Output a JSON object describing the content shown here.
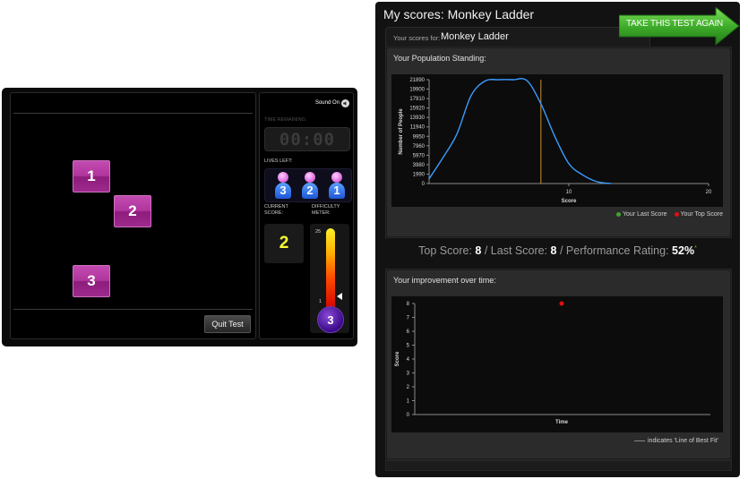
{
  "game": {
    "sound_label": "Sound On",
    "time_remaining_label": "TIME REMAINING:",
    "timer_value": "00:00",
    "lives_label": "LIVES LEFT:",
    "lives": [
      "3",
      "2",
      "1"
    ],
    "current_score_label": "CURRENT SCORE:",
    "current_score": "2",
    "difficulty_label": "DIFFICULTY METER:",
    "meter_max": "25",
    "meter_min": "1",
    "meter_value": "3",
    "tiles": [
      "1",
      "2",
      "3"
    ],
    "quit_label": "Quit Test"
  },
  "scores": {
    "title": "My scores: Monkey Ladder",
    "retake_label": "TAKE THIS TEST AGAIN",
    "scores_for_label": "Your scores for:",
    "scores_for_value": "Monkey Ladder",
    "population_title": "Your Population Standing:",
    "legend_last": "Your Last Score",
    "legend_top": "Your Top Score",
    "top_score_label": "Top Score:",
    "top_score": "8",
    "last_score_label": "/ Last Score:",
    "last_score": "8",
    "rating_label": "/ Performance Rating:",
    "rating": "52%",
    "rating_mark": "*",
    "improvement_title": "Your improvement over time:",
    "bestfit_label": "indicates 'Line of Best Fit'",
    "colors": {
      "curve": "#3a9cff",
      "last_score": "#3fa52b",
      "top_score": "#e01010",
      "retake": "#3fae2a"
    }
  },
  "chart_data": [
    {
      "type": "line",
      "title": "Your Population Standing:",
      "xlabel": "Score",
      "ylabel": "Number of People",
      "xlim": [
        0,
        20
      ],
      "ylim": [
        0,
        21890
      ],
      "xticks": [
        "10",
        "20"
      ],
      "yticks": [
        "0",
        "1990",
        "3980",
        "5970",
        "7960",
        "9950",
        "11940",
        "13930",
        "15920",
        "17910",
        "19900",
        "21890"
      ],
      "x": [
        0,
        1,
        2,
        3,
        4,
        5,
        6,
        7,
        8,
        9,
        10,
        11,
        12,
        13
      ],
      "values": [
        1000,
        5500,
        10500,
        18500,
        21600,
        21890,
        21890,
        21700,
        16800,
        9900,
        4200,
        1800,
        400,
        0
      ],
      "markers": {
        "last_score": 8,
        "top_score": 8
      }
    },
    {
      "type": "scatter",
      "title": "Your improvement over time:",
      "xlabel": "Time",
      "ylabel": "Score",
      "ylim": [
        0,
        8
      ],
      "yticks": [
        "0",
        "1",
        "2",
        "3",
        "4",
        "5",
        "6",
        "7",
        "8"
      ],
      "points": [
        {
          "x": 1,
          "y": 8
        }
      ]
    }
  ]
}
